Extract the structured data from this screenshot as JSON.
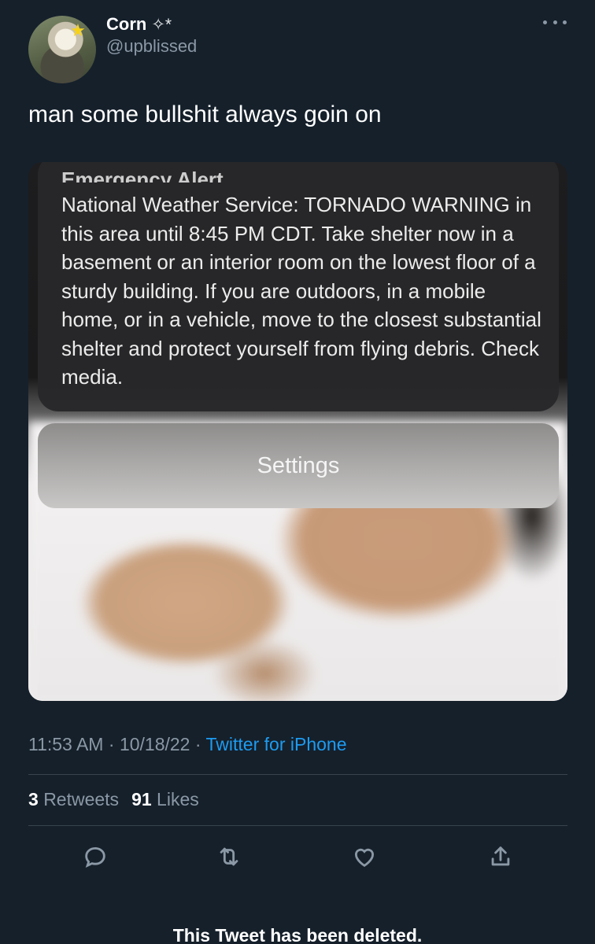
{
  "header": {
    "display_name": "Corn",
    "name_suffix": "✧*",
    "handle": "@upblissed"
  },
  "tweet": {
    "text": "man some bullshit always goin on"
  },
  "media": {
    "alert_title": "Emergency Alert",
    "alert_body": "National Weather Service: TORNADO WARNING in this area until 8:45 PM CDT. Take shelter now in a basement or an interior room on the lowest floor of a sturdy building. If you are outdoors, in a mobile home, or in a vehicle, move to the closest substantial shelter and protect yourself from flying debris. Check media.",
    "settings_label": "Settings"
  },
  "meta": {
    "time": "11:53 AM",
    "separator": "·",
    "date": "10/18/22",
    "source": "Twitter for iPhone"
  },
  "stats": {
    "retweets_count": "3",
    "retweets_label": "Retweets",
    "likes_count": "91",
    "likes_label": "Likes"
  },
  "actions": {
    "icons": [
      "reply-icon",
      "retweet-icon",
      "like-icon",
      "share-icon"
    ]
  },
  "footer": {
    "deleted_notice": "This Tweet has been deleted."
  },
  "colors": {
    "background": "#15202b",
    "accent": "#1d9bf0",
    "secondary_text": "#8b98a5"
  }
}
